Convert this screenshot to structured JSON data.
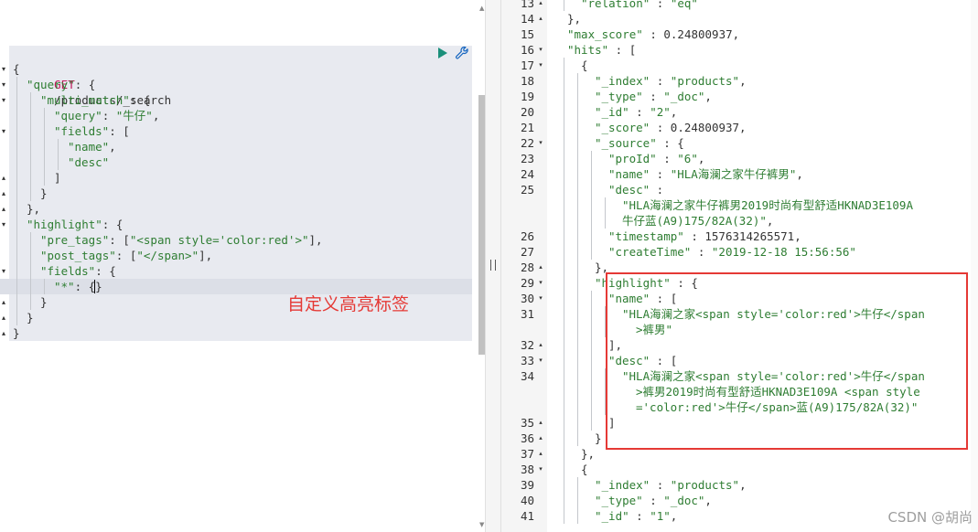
{
  "request": {
    "method": "GET",
    "path": "/products/_search",
    "lines": [
      {
        "indent": 0,
        "fold": "down",
        "parts": [
          {
            "t": "p",
            "v": "{"
          }
        ]
      },
      {
        "indent": 1,
        "fold": "down",
        "parts": [
          {
            "t": "k",
            "v": "\"query\""
          },
          {
            "t": "p",
            "v": ": {"
          }
        ]
      },
      {
        "indent": 2,
        "fold": "down",
        "parts": [
          {
            "t": "k",
            "v": "\"multi_match\""
          },
          {
            "t": "p",
            "v": ": {"
          }
        ]
      },
      {
        "indent": 3,
        "fold": "",
        "parts": [
          {
            "t": "k",
            "v": "\"query\""
          },
          {
            "t": "p",
            "v": ": "
          },
          {
            "t": "s",
            "v": "\"牛仔\""
          },
          {
            "t": "p",
            "v": ","
          }
        ]
      },
      {
        "indent": 3,
        "fold": "down",
        "parts": [
          {
            "t": "k",
            "v": "\"fields\""
          },
          {
            "t": "p",
            "v": ": ["
          }
        ]
      },
      {
        "indent": 4,
        "fold": "",
        "parts": [
          {
            "t": "s",
            "v": "\"name\""
          },
          {
            "t": "p",
            "v": ","
          }
        ]
      },
      {
        "indent": 4,
        "fold": "",
        "parts": [
          {
            "t": "s",
            "v": "\"desc\""
          }
        ]
      },
      {
        "indent": 3,
        "fold": "up",
        "parts": [
          {
            "t": "p",
            "v": "]"
          }
        ]
      },
      {
        "indent": 2,
        "fold": "up",
        "parts": [
          {
            "t": "p",
            "v": "}"
          }
        ]
      },
      {
        "indent": 1,
        "fold": "up",
        "parts": [
          {
            "t": "p",
            "v": "},"
          }
        ]
      },
      {
        "indent": 1,
        "fold": "down",
        "parts": [
          {
            "t": "k",
            "v": "\"highlight\""
          },
          {
            "t": "p",
            "v": ": {"
          }
        ]
      },
      {
        "indent": 2,
        "fold": "",
        "parts": [
          {
            "t": "k",
            "v": "\"pre_tags\""
          },
          {
            "t": "p",
            "v": ": ["
          },
          {
            "t": "s",
            "v": "\"<span style='color:red'>\""
          },
          {
            "t": "p",
            "v": "],"
          }
        ]
      },
      {
        "indent": 2,
        "fold": "",
        "parts": [
          {
            "t": "k",
            "v": "\"post_tags\""
          },
          {
            "t": "p",
            "v": ": ["
          },
          {
            "t": "s",
            "v": "\"</span>\""
          },
          {
            "t": "p",
            "v": "],"
          }
        ]
      },
      {
        "indent": 2,
        "fold": "down",
        "parts": [
          {
            "t": "k",
            "v": "\"fields\""
          },
          {
            "t": "p",
            "v": ": {"
          }
        ]
      },
      {
        "indent": 3,
        "fold": "",
        "parts": [
          {
            "t": "k",
            "v": "\"*\""
          },
          {
            "t": "p",
            "v": ": {}"
          }
        ]
      },
      {
        "indent": 2,
        "fold": "up",
        "parts": [
          {
            "t": "p",
            "v": "}"
          }
        ]
      },
      {
        "indent": 1,
        "fold": "up",
        "parts": [
          {
            "t": "p",
            "v": "}"
          }
        ]
      },
      {
        "indent": 0,
        "fold": "up",
        "parts": [
          {
            "t": "p",
            "v": "}"
          }
        ]
      }
    ]
  },
  "annotation": "自定义高亮标签",
  "response": {
    "lines": [
      {
        "n": "13",
        "fold": "up",
        "indent": 4,
        "parts": [
          {
            "t": "k",
            "v": "\"relation\""
          },
          {
            "t": "p",
            "v": " : "
          },
          {
            "t": "s",
            "v": "\"eq\""
          }
        ]
      },
      {
        "n": "14",
        "fold": "up",
        "indent": 3,
        "parts": [
          {
            "t": "p",
            "v": "},"
          }
        ]
      },
      {
        "n": "15",
        "fold": "",
        "indent": 3,
        "parts": [
          {
            "t": "k",
            "v": "\"max_score\""
          },
          {
            "t": "p",
            "v": " : 0.24800937,"
          }
        ]
      },
      {
        "n": "16",
        "fold": "down",
        "indent": 3,
        "parts": [
          {
            "t": "k",
            "v": "\"hits\""
          },
          {
            "t": "p",
            "v": " : ["
          }
        ]
      },
      {
        "n": "17",
        "fold": "down",
        "indent": 4,
        "parts": [
          {
            "t": "p",
            "v": "{"
          }
        ]
      },
      {
        "n": "18",
        "fold": "",
        "indent": 5,
        "parts": [
          {
            "t": "k",
            "v": "\"_index\""
          },
          {
            "t": "p",
            "v": " : "
          },
          {
            "t": "s",
            "v": "\"products\""
          },
          {
            "t": "p",
            "v": ","
          }
        ]
      },
      {
        "n": "19",
        "fold": "",
        "indent": 5,
        "parts": [
          {
            "t": "k",
            "v": "\"_type\""
          },
          {
            "t": "p",
            "v": " : "
          },
          {
            "t": "s",
            "v": "\"_doc\""
          },
          {
            "t": "p",
            "v": ","
          }
        ]
      },
      {
        "n": "20",
        "fold": "",
        "indent": 5,
        "parts": [
          {
            "t": "k",
            "v": "\"_id\""
          },
          {
            "t": "p",
            "v": " : "
          },
          {
            "t": "s",
            "v": "\"2\""
          },
          {
            "t": "p",
            "v": ","
          }
        ]
      },
      {
        "n": "21",
        "fold": "",
        "indent": 5,
        "parts": [
          {
            "t": "k",
            "v": "\"_score\""
          },
          {
            "t": "p",
            "v": " : 0.24800937,"
          }
        ]
      },
      {
        "n": "22",
        "fold": "down",
        "indent": 5,
        "parts": [
          {
            "t": "k",
            "v": "\"_source\""
          },
          {
            "t": "p",
            "v": " : {"
          }
        ]
      },
      {
        "n": "23",
        "fold": "",
        "indent": 6,
        "parts": [
          {
            "t": "k",
            "v": "\"proId\""
          },
          {
            "t": "p",
            "v": " : "
          },
          {
            "t": "s",
            "v": "\"6\""
          },
          {
            "t": "p",
            "v": ","
          }
        ]
      },
      {
        "n": "24",
        "fold": "",
        "indent": 6,
        "parts": [
          {
            "t": "k",
            "v": "\"name\""
          },
          {
            "t": "p",
            "v": " : "
          },
          {
            "t": "s",
            "v": "\"HLA海澜之家牛仔裤男\""
          },
          {
            "t": "p",
            "v": ","
          }
        ]
      },
      {
        "n": "25",
        "fold": "",
        "indent": 6,
        "parts": [
          {
            "t": "k",
            "v": "\"desc\""
          },
          {
            "t": "p",
            "v": " :"
          }
        ]
      },
      {
        "n": "",
        "fold": "",
        "indent": 7,
        "parts": [
          {
            "t": "s",
            "v": "\"HLA海澜之家牛仔裤男2019时尚有型舒适HKNAD3E109A"
          }
        ]
      },
      {
        "n": "",
        "fold": "",
        "indent": 7,
        "parts": [
          {
            "t": "s",
            "v": "牛仔蓝(A9)175/82A(32)\""
          },
          {
            "t": "p",
            "v": ","
          }
        ]
      },
      {
        "n": "26",
        "fold": "",
        "indent": 6,
        "parts": [
          {
            "t": "k",
            "v": "\"timestamp\""
          },
          {
            "t": "p",
            "v": " : 1576314265571,"
          }
        ]
      },
      {
        "n": "27",
        "fold": "",
        "indent": 6,
        "parts": [
          {
            "t": "k",
            "v": "\"createTime\""
          },
          {
            "t": "p",
            "v": " : "
          },
          {
            "t": "s",
            "v": "\"2019-12-18 15:56:56\""
          }
        ]
      },
      {
        "n": "28",
        "fold": "up",
        "indent": 5,
        "parts": [
          {
            "t": "p",
            "v": "},"
          }
        ]
      },
      {
        "n": "29",
        "fold": "down",
        "indent": 5,
        "parts": [
          {
            "t": "k",
            "v": "\"highlight\""
          },
          {
            "t": "p",
            "v": " : {"
          }
        ]
      },
      {
        "n": "30",
        "fold": "down",
        "indent": 6,
        "parts": [
          {
            "t": "k",
            "v": "\"name\""
          },
          {
            "t": "p",
            "v": " : ["
          }
        ]
      },
      {
        "n": "31",
        "fold": "",
        "indent": 7,
        "parts": [
          {
            "t": "s",
            "v": "\"HLA海澜之家<span style='color:red'>牛仔</span"
          }
        ]
      },
      {
        "n": "",
        "fold": "",
        "indent": 8,
        "parts": [
          {
            "t": "s",
            "v": ">裤男\""
          }
        ]
      },
      {
        "n": "32",
        "fold": "up",
        "indent": 6,
        "parts": [
          {
            "t": "p",
            "v": "],"
          }
        ]
      },
      {
        "n": "33",
        "fold": "down",
        "indent": 6,
        "parts": [
          {
            "t": "k",
            "v": "\"desc\""
          },
          {
            "t": "p",
            "v": " : ["
          }
        ]
      },
      {
        "n": "34",
        "fold": "",
        "indent": 7,
        "parts": [
          {
            "t": "s",
            "v": "\"HLA海澜之家<span style='color:red'>牛仔</span"
          }
        ]
      },
      {
        "n": "",
        "fold": "",
        "indent": 8,
        "parts": [
          {
            "t": "s",
            "v": ">裤男2019时尚有型舒适HKNAD3E109A <span style"
          }
        ]
      },
      {
        "n": "",
        "fold": "",
        "indent": 8,
        "parts": [
          {
            "t": "s",
            "v": "='color:red'>牛仔</span>蓝(A9)175/82A(32)\""
          }
        ]
      },
      {
        "n": "35",
        "fold": "up",
        "indent": 6,
        "parts": [
          {
            "t": "p",
            "v": "]"
          }
        ]
      },
      {
        "n": "36",
        "fold": "up",
        "indent": 5,
        "parts": [
          {
            "t": "p",
            "v": "}"
          }
        ]
      },
      {
        "n": "37",
        "fold": "up",
        "indent": 4,
        "parts": [
          {
            "t": "p",
            "v": "},"
          }
        ]
      },
      {
        "n": "38",
        "fold": "down",
        "indent": 4,
        "parts": [
          {
            "t": "p",
            "v": "{"
          }
        ]
      },
      {
        "n": "39",
        "fold": "",
        "indent": 5,
        "parts": [
          {
            "t": "k",
            "v": "\"_index\""
          },
          {
            "t": "p",
            "v": " : "
          },
          {
            "t": "s",
            "v": "\"products\""
          },
          {
            "t": "p",
            "v": ","
          }
        ]
      },
      {
        "n": "40",
        "fold": "",
        "indent": 5,
        "parts": [
          {
            "t": "k",
            "v": "\"_type\""
          },
          {
            "t": "p",
            "v": " : "
          },
          {
            "t": "s",
            "v": "\"_doc\""
          },
          {
            "t": "p",
            "v": ","
          }
        ]
      },
      {
        "n": "41",
        "fold": "",
        "indent": 5,
        "parts": [
          {
            "t": "k",
            "v": "\"_id\""
          },
          {
            "t": "p",
            "v": " : "
          },
          {
            "t": "s",
            "v": "\"1\""
          },
          {
            "t": "p",
            "v": ","
          }
        ]
      }
    ]
  },
  "watermark": "CSDN @胡尚",
  "icons": {
    "run": "play-icon",
    "settings": "wrench-icon"
  },
  "colors": {
    "key": "#2e7d32",
    "method": "#c2185b",
    "annotation": "#e53935",
    "run": "#1a8f7a"
  }
}
